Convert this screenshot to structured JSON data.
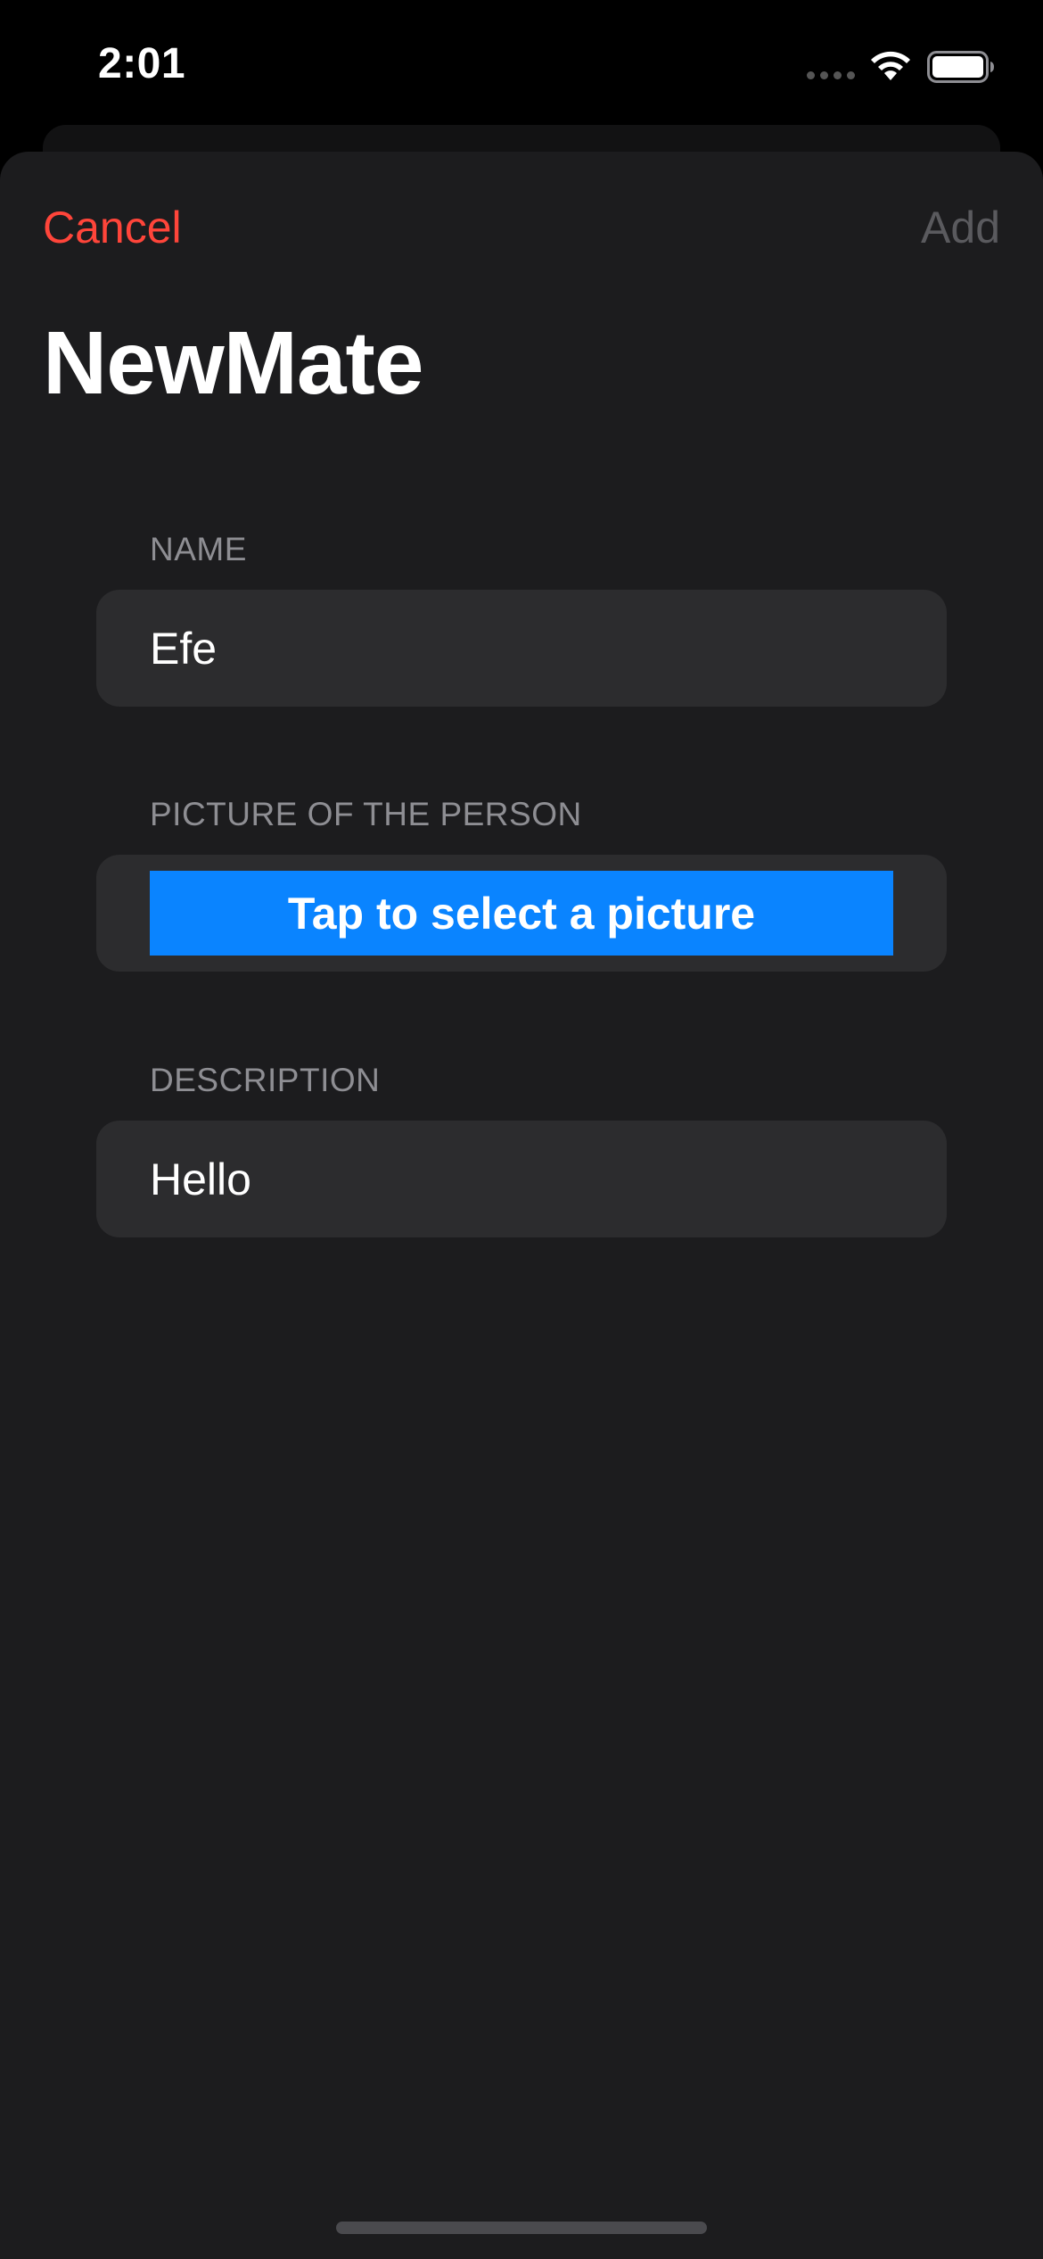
{
  "status_bar": {
    "time": "2:01",
    "icons": [
      "signal-dots-icon",
      "wifi-icon",
      "battery-icon"
    ]
  },
  "nav": {
    "cancel_label": "Cancel",
    "add_label": "Add",
    "cancel_color": "#ff453a",
    "add_color": "#5a5a5e"
  },
  "page": {
    "title": "NewMate"
  },
  "form": {
    "name": {
      "header": "NAME",
      "value": "Efe"
    },
    "picture": {
      "header": "PICTURE OF THE PERSON",
      "button_label": "Tap to select a picture",
      "button_color": "#0a84ff"
    },
    "description": {
      "header": "DESCRIPTION",
      "value": "Hello"
    }
  }
}
